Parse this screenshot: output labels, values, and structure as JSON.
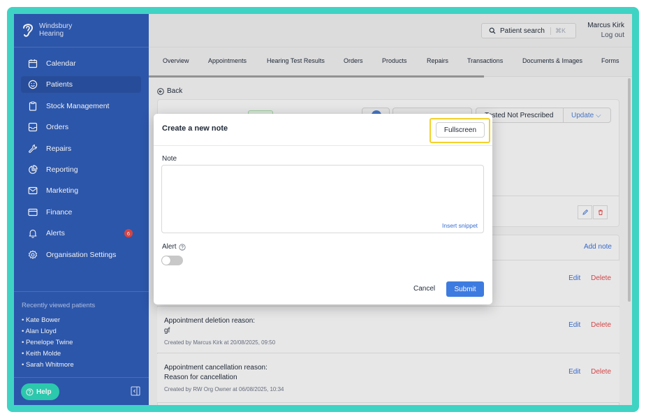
{
  "brand": {
    "line1": "Windsbury",
    "line2": "Hearing"
  },
  "sidebar": {
    "items": [
      {
        "label": "Calendar",
        "icon": "calendar-icon"
      },
      {
        "label": "Patients",
        "icon": "smiley-icon",
        "active": true
      },
      {
        "label": "Stock Management",
        "icon": "clipboard-icon"
      },
      {
        "label": "Orders",
        "icon": "inbox-icon"
      },
      {
        "label": "Repairs",
        "icon": "wrench-icon"
      },
      {
        "label": "Reporting",
        "icon": "pie-chart-icon"
      },
      {
        "label": "Marketing",
        "icon": "mail-icon"
      },
      {
        "label": "Finance",
        "icon": "card-icon"
      },
      {
        "label": "Alerts",
        "icon": "bell-icon",
        "badge": "6"
      },
      {
        "label": "Organisation Settings",
        "icon": "gear-icon"
      }
    ],
    "recent_title": "Recently viewed patients",
    "recent": [
      "• Kate Bower",
      "• Alan Lloyd",
      "• Penelope Twine",
      "• Keith Molde",
      "• Sarah Whitmore"
    ],
    "help_label": "Help"
  },
  "header": {
    "search_label": "Patient search",
    "search_shortcut": "⌘K",
    "user_name": "Marcus Kirk",
    "logout_label": "Log out"
  },
  "tabs": [
    "Overview",
    "Appointments",
    "Hearing Test Results",
    "Orders",
    "Products",
    "Repairs",
    "Transactions",
    "Documents & Images",
    "Forms"
  ],
  "page": {
    "back_label": "Back",
    "patient_status": "Tested Not Prescribed",
    "update_label": "Update",
    "add_note_label": "Add note",
    "notes": [
      {
        "title": "",
        "content": "",
        "meta": ""
      },
      {
        "title": "Appointment deletion reason:",
        "content": "gf",
        "meta": "Created by Marcus Kirk at 20/08/2025, 09:50"
      },
      {
        "title": "Appointment cancellation reason:",
        "content": "Reason for cancellation",
        "meta": "Created by RW Org Owner at 06/08/2025, 10:34"
      }
    ],
    "edit_label": "Edit",
    "delete_label": "Delete"
  },
  "modal": {
    "title": "Create a new note",
    "fullscreen_label": "Fullscreen",
    "note_label": "Note",
    "note_value": "",
    "insert_snippet_label": "Insert snippet",
    "alert_label": "Alert",
    "alert_on": false,
    "cancel_label": "Cancel",
    "submit_label": "Submit"
  },
  "colors": {
    "sidebar": "#2f5bb4",
    "accent": "#3e7be0",
    "frame": "#3fd3c4",
    "danger": "#e04848",
    "highlight": "#f4d12b",
    "help": "#2ed3b7"
  }
}
